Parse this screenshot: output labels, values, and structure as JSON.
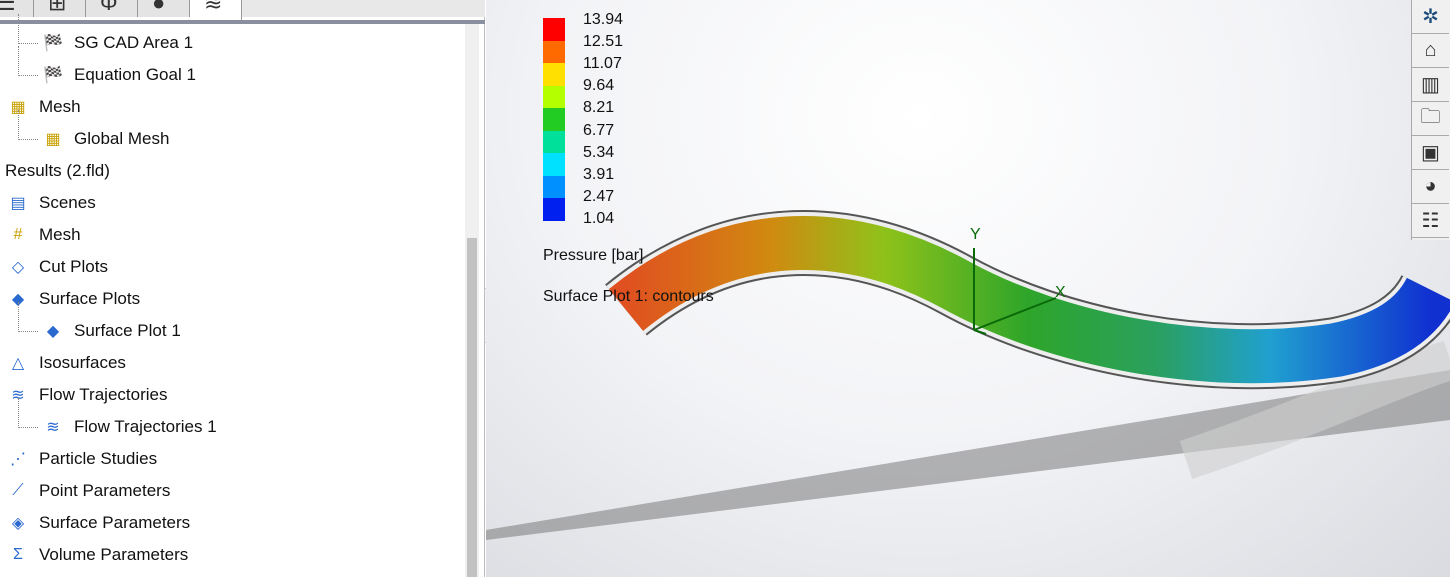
{
  "tabs": [
    {
      "icon": "feature-tree-icon"
    },
    {
      "icon": "property-manager-icon"
    },
    {
      "icon": "configuration-icon"
    },
    {
      "icon": "display-manager-icon"
    },
    {
      "icon": "flow-simulation-icon"
    }
  ],
  "tree": [
    {
      "label": "SG CAD Area 1",
      "icon": "goal-flag-icon",
      "indent": 1
    },
    {
      "label": "Equation Goal 1",
      "icon": "equation-goal-icon",
      "indent": 1
    },
    {
      "label": "Mesh",
      "icon": "mesh-icon",
      "indent": 0
    },
    {
      "label": "Global Mesh",
      "icon": "global-mesh-icon",
      "indent": 1
    },
    {
      "label": "Results (2.fld)",
      "icon": "",
      "indent": 0
    },
    {
      "label": "Scenes",
      "icon": "scenes-icon",
      "indent": 0
    },
    {
      "label": "Mesh",
      "icon": "results-mesh-icon",
      "indent": 0
    },
    {
      "label": "Cut Plots",
      "icon": "cut-plot-icon",
      "indent": 0
    },
    {
      "label": "Surface Plots",
      "icon": "surface-plot-icon",
      "indent": 0
    },
    {
      "label": "Surface Plot 1",
      "icon": "surface-plot-icon",
      "indent": 1
    },
    {
      "label": "Isosurfaces",
      "icon": "isosurface-icon",
      "indent": 0
    },
    {
      "label": "Flow Trajectories",
      "icon": "flow-trajectories-icon",
      "indent": 0
    },
    {
      "label": "Flow Trajectories 1",
      "icon": "flow-trajectories-icon",
      "indent": 1
    },
    {
      "label": "Particle Studies",
      "icon": "particle-studies-icon",
      "indent": 0
    },
    {
      "label": "Point Parameters",
      "icon": "point-parameters-icon",
      "indent": 0
    },
    {
      "label": "Surface Parameters",
      "icon": "surface-parameters-icon",
      "indent": 0
    },
    {
      "label": "Volume Parameters",
      "icon": "volume-parameters-icon",
      "indent": 0
    }
  ],
  "legend": {
    "values": [
      "13.94",
      "12.51",
      "11.07",
      "9.64",
      "8.21",
      "6.77",
      "5.34",
      "3.91",
      "2.47",
      "1.04"
    ],
    "colors": [
      "#ff0000",
      "#ff6a00",
      "#ffe000",
      "#b4ff00",
      "#22cc22",
      "#00e09a",
      "#00e0ff",
      "#0090ff",
      "#0020f0"
    ],
    "quantity": "Pressure [bar]",
    "plot": "Surface Plot 1: contours"
  },
  "axes": {
    "x": "X",
    "y": "Y"
  },
  "right_toolbar": [
    "view-cube-icon",
    "home-icon",
    "resources-icon",
    "file-explorer-icon",
    "view-palette-icon",
    "appearances-icon",
    "custom-properties-icon"
  ]
}
